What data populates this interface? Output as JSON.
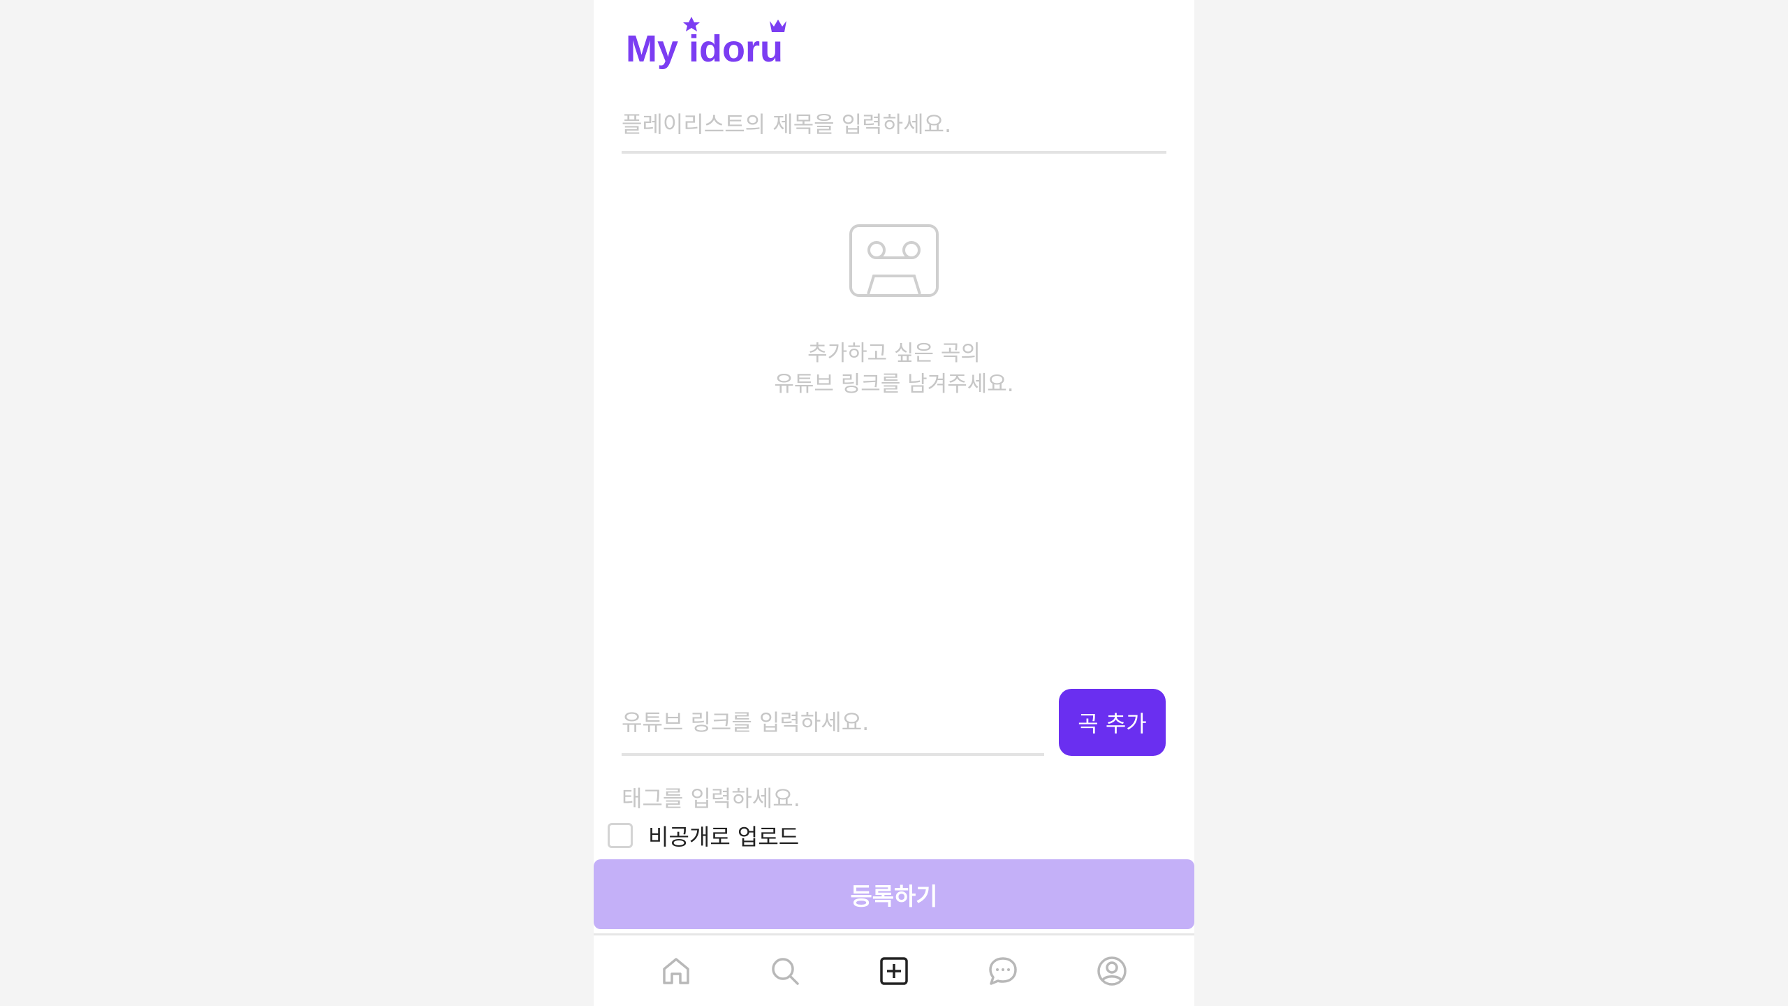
{
  "app": {
    "logo_text": "My idoru"
  },
  "form": {
    "title_placeholder": "플레이리스트의 제목을 입력하세요.",
    "empty_state": {
      "icon": "cassette-icon",
      "line1": "추가하고 싶은 곡의",
      "line2": "유튜브 링크를 남겨주세요."
    },
    "link_placeholder": "유튜브 링크를 입력하세요.",
    "add_song_label": "곡 추가",
    "tag_placeholder": "태그를 입력하세요.",
    "private_label": "비공개로 업로드",
    "private_checked": false,
    "submit_label": "등록하기"
  },
  "nav": {
    "items": [
      {
        "icon": "home-icon",
        "active": false
      },
      {
        "icon": "search-icon",
        "active": false
      },
      {
        "icon": "plus-square-icon",
        "active": true
      },
      {
        "icon": "chat-icon",
        "active": false
      },
      {
        "icon": "profile-icon",
        "active": false
      }
    ]
  },
  "colors": {
    "brand": "#6a2ff0",
    "submit_disabled": "#c4b0f8",
    "placeholder": "#c6c6c6",
    "inactive_icon": "#b8b8b8",
    "active_icon": "#222222"
  }
}
